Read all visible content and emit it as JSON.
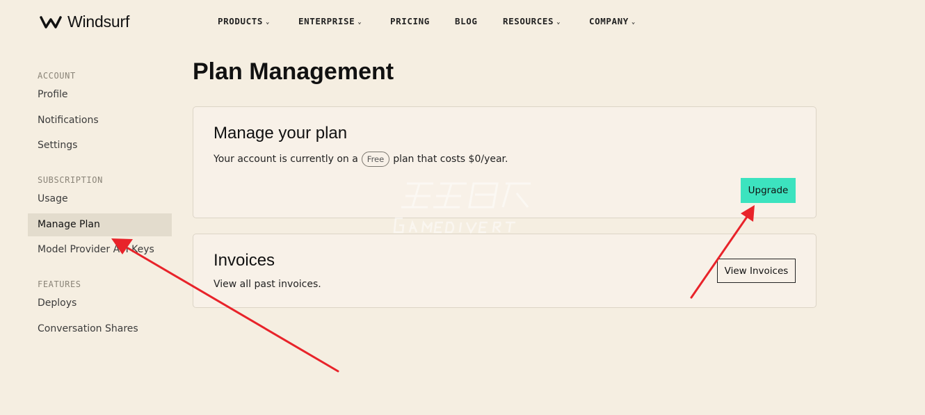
{
  "brand": {
    "name": "Windsurf"
  },
  "nav": [
    {
      "label": "PRODUCTS",
      "has_dropdown": true
    },
    {
      "label": "ENTERPRISE",
      "has_dropdown": true
    },
    {
      "label": "PRICING",
      "has_dropdown": false
    },
    {
      "label": "BLOG",
      "has_dropdown": false
    },
    {
      "label": "RESOURCES",
      "has_dropdown": true
    },
    {
      "label": "COMPANY",
      "has_dropdown": true
    }
  ],
  "sidebar": {
    "account": {
      "heading": "ACCOUNT",
      "items": [
        "Profile",
        "Notifications",
        "Settings"
      ]
    },
    "subscription": {
      "heading": "SUBSCRIPTION",
      "items": [
        "Usage",
        "Manage Plan",
        "Model Provider API Keys"
      ]
    },
    "features": {
      "heading": "FEATURES",
      "items": [
        "Deploys",
        "Conversation Shares"
      ]
    },
    "active_item": "Manage Plan"
  },
  "page": {
    "title": "Plan Management"
  },
  "plan_card": {
    "title": "Manage your plan",
    "text_before": "Your account is currently on a",
    "plan_badge": "Free",
    "text_after": "plan that costs $0/year.",
    "upgrade_label": "Upgrade"
  },
  "invoices_card": {
    "title": "Invoices",
    "text": "View all past invoices.",
    "button_label": "View Invoices"
  },
  "colors": {
    "background": "#f5eee1",
    "accent": "#3ce3bf",
    "annotation_arrow": "#e8232a"
  }
}
